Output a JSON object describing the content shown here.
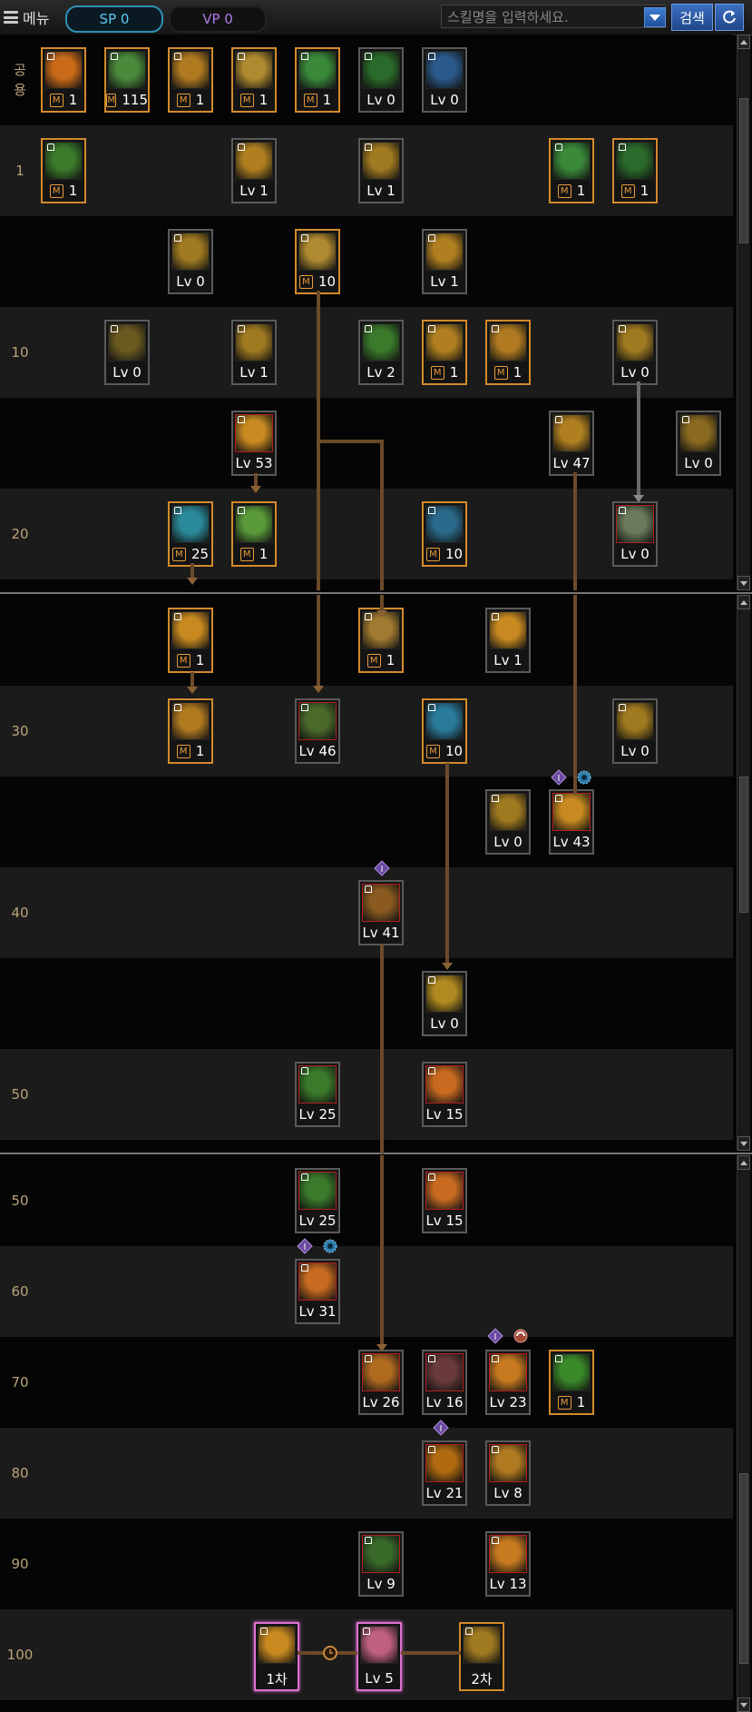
{
  "topbar": {
    "menu_label": "메뉴",
    "sp_label": "SP 0",
    "vp_label": "VP 0",
    "search_placeholder": "스킬명을 입력하세요.",
    "search_button": "검색"
  },
  "colors": {
    "accent_blue": "#2f8fb5",
    "gold_border": "#d38a2a",
    "row_label": "#bba37a",
    "connector": "#6b4a2a",
    "vp_text": "#b07ae6"
  },
  "panels": [
    {
      "rows": [
        {
          "label": "공\n용",
          "skills": [
            {
              "col": 0,
              "text": "1",
              "m": true,
              "color": "#c86a18"
            },
            {
              "col": 1,
              "text": "115",
              "m": true,
              "color": "#4a8a3a"
            },
            {
              "col": 2,
              "text": "1",
              "m": true,
              "color": "#b07a20"
            },
            {
              "col": 3,
              "text": "1",
              "m": true,
              "color": "#b08a30"
            },
            {
              "col": 4,
              "text": "1",
              "m": true,
              "color": "#3a8a3a"
            },
            {
              "col": 5,
              "text": "Lv 0",
              "m": false,
              "color": "#2a6a2a"
            },
            {
              "col": 6,
              "text": "Lv 0",
              "m": false,
              "color": "#2a5a8a"
            }
          ]
        },
        {
          "label": "1",
          "skills": [
            {
              "col": 0,
              "text": "1",
              "m": true,
              "color": "#3a7a2a"
            },
            {
              "col": 3,
              "text": "Lv 1",
              "m": false,
              "color": "#b08020"
            },
            {
              "col": 5,
              "text": "Lv 1",
              "m": false,
              "color": "#a07a20"
            },
            {
              "col": 8,
              "text": "1",
              "m": true,
              "color": "#3a8a3a"
            },
            {
              "col": 9,
              "text": "1",
              "m": true,
              "color": "#2a6a2a"
            }
          ]
        },
        {
          "label": "",
          "skills": [
            {
              "col": 2,
              "text": "Lv 0",
              "m": false,
              "color": "#a07a20"
            },
            {
              "col": 4,
              "text": "10",
              "m": true,
              "color": "#b08a30"
            },
            {
              "col": 6,
              "text": "Lv 1",
              "m": false,
              "color": "#b08020"
            }
          ]
        },
        {
          "label": "10",
          "skills": [
            {
              "col": 1,
              "text": "Lv 0",
              "m": false,
              "color": "#6a5a20"
            },
            {
              "col": 3,
              "text": "Lv 1",
              "m": false,
              "color": "#a07a20"
            },
            {
              "col": 5,
              "text": "Lv 2",
              "m": false,
              "color": "#3a7a2a"
            },
            {
              "col": 6,
              "text": "1",
              "m": true,
              "color": "#b08020"
            },
            {
              "col": 7,
              "text": "1",
              "m": true,
              "color": "#b07a20"
            },
            {
              "col": 9,
              "text": "Lv 0",
              "m": false,
              "color": "#a07a20"
            }
          ]
        },
        {
          "label": "",
          "skills": [
            {
              "col": 3,
              "text": "Lv 53",
              "m": false,
              "color": "#c88a20",
              "red": true
            },
            {
              "col": 8,
              "text": "Lv 47",
              "m": false,
              "color": "#b08020"
            },
            {
              "col": 10,
              "text": "Lv 0",
              "m": false,
              "color": "#8a6a20"
            }
          ]
        },
        {
          "label": "20",
          "skills": [
            {
              "col": 2,
              "text": "25",
              "m": true,
              "color": "#2a8a9a"
            },
            {
              "col": 3,
              "text": "1",
              "m": true,
              "color": "#5a9a3a"
            },
            {
              "col": 6,
              "text": "10",
              "m": true,
              "color": "#2a6a8a"
            },
            {
              "col": 9,
              "text": "Lv 0",
              "m": false,
              "color": "#6a7a5a",
              "red": true
            }
          ]
        }
      ]
    },
    {
      "rows": [
        {
          "label": "",
          "skills": [
            {
              "col": 2,
              "text": "1",
              "m": true,
              "color": "#c88a20"
            },
            {
              "col": 5,
              "text": "1",
              "m": true,
              "color": "#a07a30"
            },
            {
              "col": 7,
              "text": "Lv 1",
              "m": false,
              "color": "#c88a20"
            }
          ]
        },
        {
          "label": "30",
          "skills": [
            {
              "col": 2,
              "text": "1",
              "m": true,
              "color": "#b07a20"
            },
            {
              "col": 4,
              "text": "Lv 46",
              "m": false,
              "color": "#4a6a2a",
              "red": true
            },
            {
              "col": 6,
              "text": "10",
              "m": true,
              "color": "#2a7a9a"
            },
            {
              "col": 9,
              "text": "Lv 0",
              "m": false,
              "color": "#a07a20"
            }
          ]
        },
        {
          "label": "",
          "skills": [
            {
              "col": 7,
              "text": "Lv 0",
              "m": false,
              "color": "#a07a20"
            },
            {
              "col": 8,
              "text": "Lv 43",
              "m": false,
              "color": "#c88a20",
              "red": true
            }
          ]
        },
        {
          "label": "40",
          "skills": [
            {
              "col": 5,
              "text": "Lv 41",
              "m": false,
              "color": "#8a5a20",
              "red": true
            }
          ]
        },
        {
          "label": "",
          "skills": [
            {
              "col": 6,
              "text": "Lv 0",
              "m": false,
              "color": "#b08a20"
            }
          ]
        },
        {
          "label": "50",
          "skills": [
            {
              "col": 4,
              "text": "Lv 25",
              "m": false,
              "color": "#3a7a2a",
              "red": true
            },
            {
              "col": 6,
              "text": "Lv 15",
              "m": false,
              "color": "#c86a20",
              "red": true
            }
          ]
        }
      ]
    },
    {
      "rows": [
        {
          "label": "50",
          "skills": [
            {
              "col": 4,
              "text": "Lv 25",
              "m": false,
              "color": "#3a7a2a",
              "red": true
            },
            {
              "col": 6,
              "text": "Lv 15",
              "m": false,
              "color": "#c86a20",
              "red": true
            }
          ]
        },
        {
          "label": "60",
          "skills": [
            {
              "col": 4,
              "text": "Lv 31",
              "m": false,
              "color": "#c86a20",
              "red": true
            }
          ]
        },
        {
          "label": "70",
          "skills": [
            {
              "col": 5,
              "text": "Lv 26",
              "m": false,
              "color": "#b06a20",
              "red": true
            },
            {
              "col": 6,
              "text": "Lv 16",
              "m": false,
              "color": "#6a3a3a",
              "red": true
            },
            {
              "col": 7,
              "text": "Lv 23",
              "m": false,
              "color": "#c87a20",
              "red": true
            },
            {
              "col": 8,
              "text": "1",
              "m": true,
              "color": "#3a8a2a"
            }
          ]
        },
        {
          "label": "80",
          "skills": [
            {
              "col": 6,
              "text": "Lv 21",
              "m": false,
              "color": "#b06a10",
              "red": true
            },
            {
              "col": 7,
              "text": "Lv 8",
              "m": false,
              "color": "#b07a20",
              "red": true
            }
          ]
        },
        {
          "label": "90",
          "skills": [
            {
              "col": 5,
              "text": "Lv 9",
              "m": false,
              "color": "#3a6a2a",
              "red": true
            },
            {
              "col": 7,
              "text": "Lv 13",
              "m": false,
              "color": "#c87a20",
              "red": true
            }
          ]
        },
        {
          "label": "100",
          "skills": [
            {
              "col": "a",
              "text": "1차",
              "m": false,
              "color": "#c88a20"
            },
            {
              "col": "b",
              "text": "Lv 5",
              "m": false,
              "color": "#c06080"
            },
            {
              "col": "c",
              "text": "2차",
              "m": false,
              "color": "#a07a20"
            }
          ]
        }
      ]
    }
  ]
}
